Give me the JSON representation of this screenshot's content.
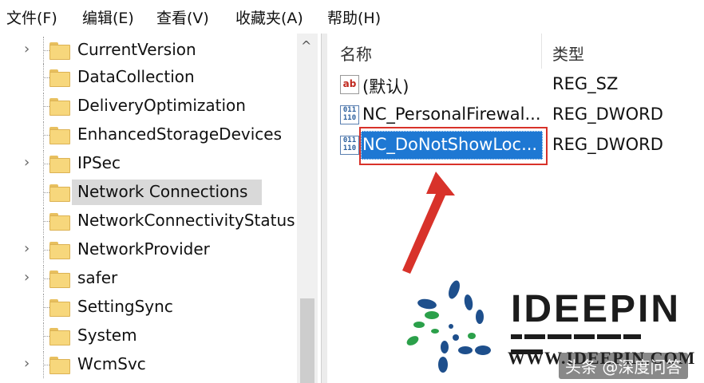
{
  "menu": [
    "文件(F)",
    "编辑(E)",
    "查看(V)",
    "收藏夹(A)",
    "帮助(H)"
  ],
  "tree": {
    "items": [
      {
        "label": "CurrentVersion",
        "expandable": true
      },
      {
        "label": "DataCollection",
        "expandable": false
      },
      {
        "label": "DeliveryOptimization",
        "expandable": false
      },
      {
        "label": "EnhancedStorageDevices",
        "expandable": false
      },
      {
        "label": "IPSec",
        "expandable": true
      },
      {
        "label": "Network Connections",
        "expandable": false,
        "selected": true
      },
      {
        "label": "NetworkConnectivityStatus",
        "expandable": false
      },
      {
        "label": "NetworkProvider",
        "expandable": true
      },
      {
        "label": "safer",
        "expandable": true
      },
      {
        "label": "SettingSync",
        "expandable": false
      },
      {
        "label": "System",
        "expandable": false
      },
      {
        "label": "WcmSvc",
        "expandable": true
      }
    ],
    "scroll_up_glyph": "^"
  },
  "values": {
    "headers": {
      "name": "名称",
      "type": "类型"
    },
    "rows": [
      {
        "name": "(默认)",
        "type": "REG_SZ",
        "icon": "ab-string-icon"
      },
      {
        "name": "NC_PersonalFirewal...",
        "type": "REG_DWORD",
        "icon": "binary-dword-icon"
      },
      {
        "name": "NC_DoNotShowLoc...",
        "type": "REG_DWORD",
        "icon": "binary-dword-icon",
        "selected": true
      }
    ],
    "sz_icon_text": "ab",
    "dword_icon_text": "011\n110"
  },
  "annotations": {
    "highlight_color": "#d8322a",
    "selection_color": "#1e78d3"
  },
  "brand": {
    "name": "IDEEPIN",
    "url": "WWW.IDEEPIN.COM",
    "watermark": "头条 @深度问答"
  }
}
